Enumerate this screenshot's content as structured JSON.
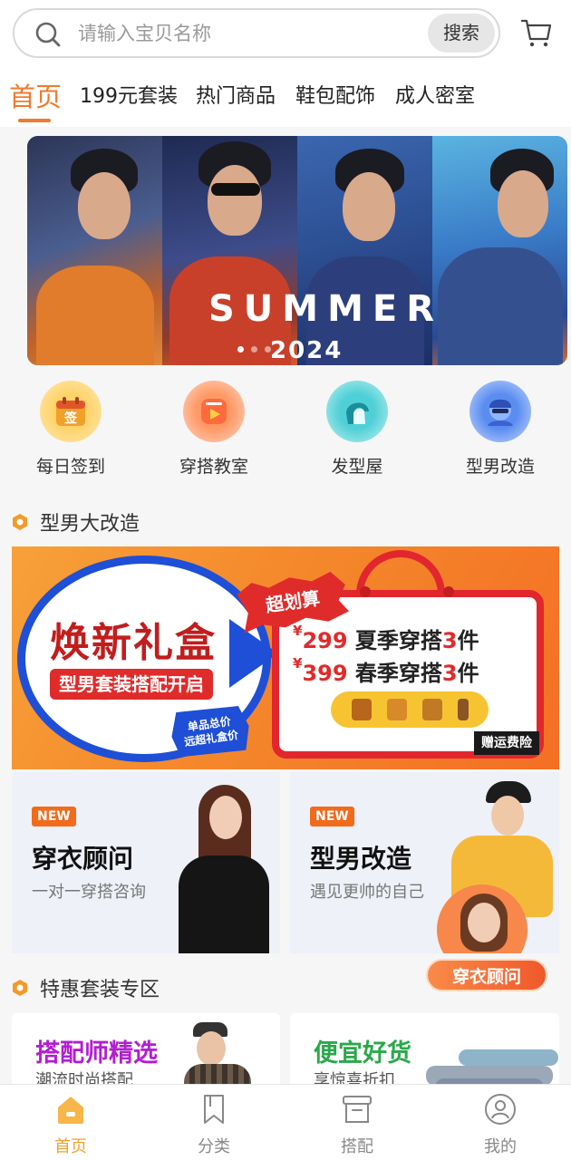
{
  "search": {
    "placeholder": "请输入宝贝名称",
    "button_label": "搜索"
  },
  "tabs": [
    {
      "label": "首页",
      "active": true
    },
    {
      "label": "199元套装"
    },
    {
      "label": "热门商品"
    },
    {
      "label": "鞋包配饰"
    },
    {
      "label": "成人密室"
    }
  ],
  "banner": {
    "headline": "SUMMER",
    "year": "2024",
    "slide_count": 3,
    "active_slide": 1
  },
  "quick_menu": [
    {
      "label": "每日签到",
      "icon": "calendar-sign-icon",
      "glyph": "签"
    },
    {
      "label": "穿搭教室",
      "icon": "video-class-icon"
    },
    {
      "label": "发型屋",
      "icon": "hairstyle-icon"
    },
    {
      "label": "型男改造",
      "icon": "makeover-avatar-icon"
    }
  ],
  "section_makeover": {
    "title": "型男大改造"
  },
  "promo": {
    "title": "焕新礼盒",
    "subtitle": "型男套装搭配开启",
    "burst_label": "超划算",
    "badge_line1": "单品总价",
    "badge_line2": "远超礼盒价",
    "offers": [
      {
        "currency": "¥",
        "price": "299",
        "text": "夏季穿搭",
        "count": "3",
        "unit": "件"
      },
      {
        "currency": "¥",
        "price": "399",
        "text": "春季穿搭",
        "count": "3",
        "unit": "件"
      }
    ],
    "shipping": "赠运费险"
  },
  "cards": [
    {
      "badge": "NEW",
      "title": "穿衣顾问",
      "subtitle": "一对一穿搭咨询"
    },
    {
      "badge": "NEW",
      "title": "型男改造",
      "subtitle": "遇见更帅的自己",
      "overlay_label": "穿衣顾问"
    }
  ],
  "section_deals": {
    "title": "特惠套装专区"
  },
  "deal_cards": [
    {
      "title": "搭配师精选",
      "subtitle": "潮流时尚搭配",
      "title_color": "#b21ed0"
    },
    {
      "title": "便宜好货",
      "subtitle": "享惊喜折扣",
      "title_color": "#2aa84a"
    }
  ],
  "bottom_nav": [
    {
      "label": "首页",
      "icon": "home-icon",
      "active": true
    },
    {
      "label": "分类",
      "icon": "bookmark-icon"
    },
    {
      "label": "搭配",
      "icon": "box-icon"
    },
    {
      "label": "我的",
      "icon": "user-icon"
    }
  ],
  "colors": {
    "accent": "#f07a2e",
    "nav_active": "#f0a130"
  }
}
